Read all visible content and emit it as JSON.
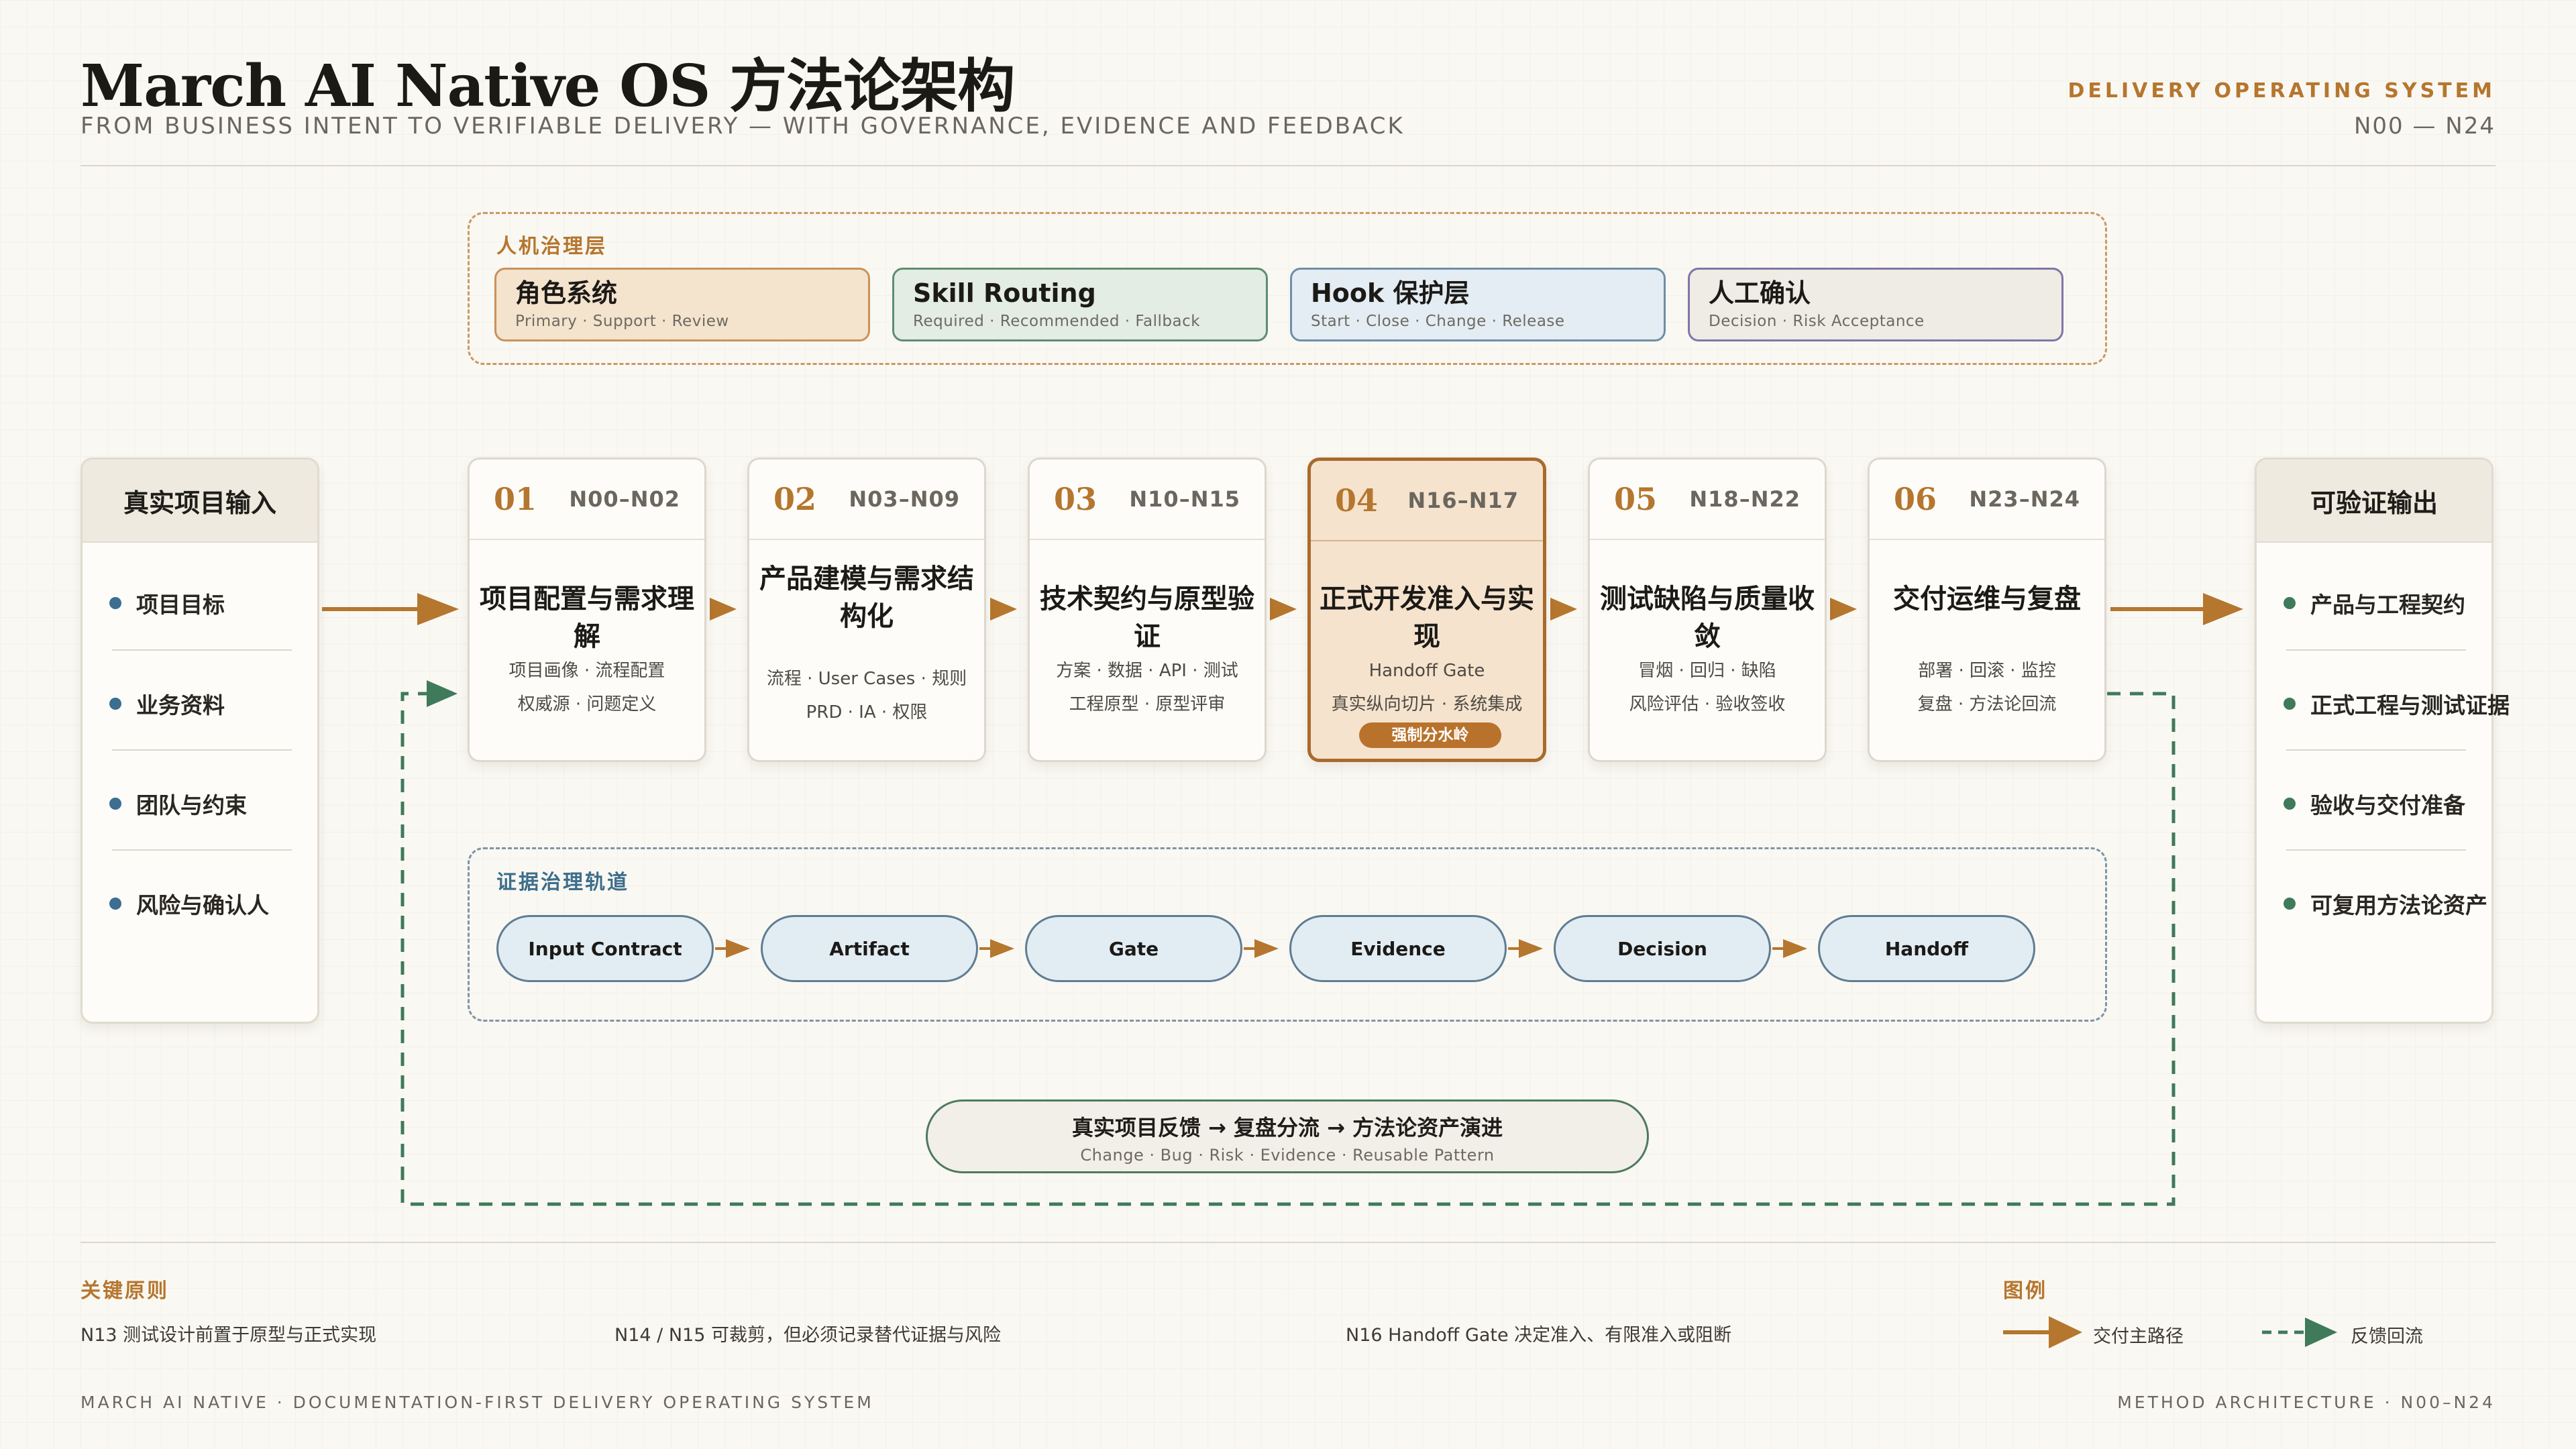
{
  "header": {
    "title": "March AI Native OS 方法论架构",
    "subtitle": "FROM BUSINESS INTENT TO VERIFIABLE DELIVERY — WITH GOVERNANCE, EVIDENCE AND FEEDBACK",
    "kicker": "DELIVERY OPERATING SYSTEM",
    "range": "N00 — N24"
  },
  "governance": {
    "label": "人机治理层",
    "cards": [
      {
        "title": "角色系统",
        "sub": "Primary · Support · Review",
        "bg": "#f4e3cd",
        "border": "#c9925a"
      },
      {
        "title": "Skill Routing",
        "sub": "Required · Recommended · Fallback",
        "bg": "#e3ede4",
        "border": "#5f8d70"
      },
      {
        "title": "Hook 保护层",
        "sub": "Start · Close · Change · Release",
        "bg": "#e4edf3",
        "border": "#6e8ea6"
      },
      {
        "title": "人工确认",
        "sub": "Decision · Risk Acceptance",
        "bg": "#efebe5",
        "border": "#7f76a6"
      }
    ]
  },
  "input": {
    "title": "真实项目输入",
    "items": [
      "项目目标",
      "业务资料",
      "团队与约束",
      "风险与确认人"
    ],
    "dot_color": "#3b6e8f"
  },
  "output": {
    "title": "可验证输出",
    "items": [
      "产品与工程契约",
      "正式工程与测试证据",
      "验收与交付准备",
      "可复用方法论资产"
    ],
    "dot_color": "#3f7a5a"
  },
  "stages": [
    {
      "num": "01",
      "range": "N00–N02",
      "title": "项目配置与需求理解",
      "lines": [
        "项目画像 · 流程配置",
        "权威源 · 问题定义"
      ]
    },
    {
      "num": "02",
      "range": "N03–N09",
      "title": "产品建模与需求结构化",
      "title_lines": [
        "产品建模与需求结",
        "构化"
      ],
      "lines": [
        "流程 · User Cases · 规则",
        "PRD · IA · 权限"
      ]
    },
    {
      "num": "03",
      "range": "N10–N15",
      "title": "技术契约与原型验证",
      "lines": [
        "方案 · 数据 · API · 测试",
        "工程原型 · 原型评审"
      ]
    },
    {
      "num": "04",
      "range": "N16–N17",
      "title": "正式开发准入与实现",
      "lines": [
        "Handoff Gate",
        "真实纵向切片 · 系统集成"
      ],
      "badge": "强制分水岭",
      "highlight": true
    },
    {
      "num": "05",
      "range": "N18–N22",
      "title": "测试缺陷与质量收敛",
      "lines": [
        "冒烟 · 回归 · 缺陷",
        "风险评估 · 验收签收"
      ]
    },
    {
      "num": "06",
      "range": "N23–N24",
      "title": "交付运维与复盘",
      "lines": [
        "部署 · 回滚 · 监控",
        "复盘 · 方法论回流"
      ]
    }
  ],
  "evidence": {
    "label": "证据治理轨道",
    "steps": [
      "Input Contract",
      "Artifact",
      "Gate",
      "Evidence",
      "Decision",
      "Handoff"
    ]
  },
  "feedback": {
    "title": "真实项目反馈 → 复盘分流 → 方法论资产演进",
    "sub": "Change · Bug · Risk · Evidence · Reusable Pattern"
  },
  "principles": {
    "label": "关键原则",
    "items": [
      "N13 测试设计前置于原型与正式实现",
      "N14 / N15 可裁剪，但必须记录替代证据与风险",
      "N16 Handoff Gate 决定准入、有限准入或阻断"
    ]
  },
  "legend": {
    "label": "图例",
    "main": "交付主路径",
    "feedback": "反馈回流"
  },
  "colors": {
    "main_arrow": "#b5762e",
    "feedback_arrow": "#3f7a5a",
    "accent": "#b5762e"
  },
  "footer": {
    "left": "MARCH AI NATIVE · DOCUMENTATION-FIRST DELIVERY OPERATING SYSTEM",
    "right": "METHOD ARCHITECTURE · N00–N24"
  }
}
